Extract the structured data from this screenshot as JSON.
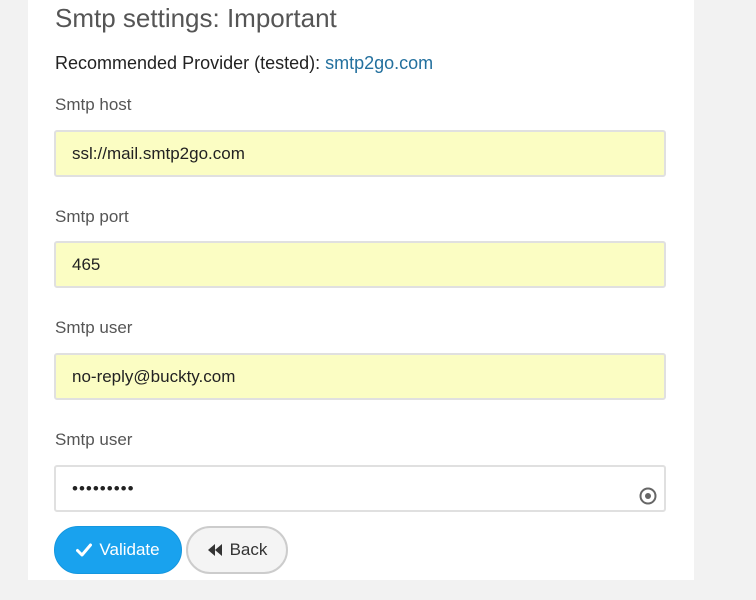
{
  "page": {
    "title": "Smtp settings: Important",
    "provider_prefix": "Recommended Provider (tested): ",
    "provider_link": "smtp2go.com"
  },
  "fields": {
    "host": {
      "label": "Smtp host",
      "value": "ssl://mail.smtp2go.com"
    },
    "port": {
      "label": "Smtp port",
      "value": "465"
    },
    "user": {
      "label": "Smtp user",
      "value": "no-reply@buckty.com"
    },
    "password": {
      "label": "Smtp user",
      "value": "•••••••••"
    }
  },
  "buttons": {
    "validate": "Validate",
    "back": "Back"
  },
  "colors": {
    "accent": "#19a2ee",
    "autofill_bg": "#fbfdc3",
    "link": "#23709e"
  },
  "icons": {
    "validate": "check-icon",
    "back": "double-chevron-left-icon",
    "password": "password-reveal-icon"
  }
}
